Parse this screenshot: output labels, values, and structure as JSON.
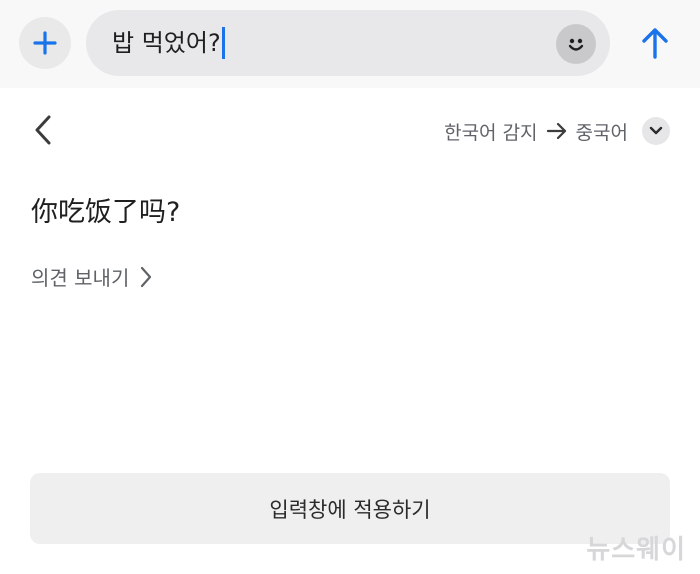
{
  "composer": {
    "input_value": "밥 먹었어?",
    "icons": {
      "add": "plus-icon",
      "emoji": "smiley-icon",
      "send": "arrow-up-icon"
    }
  },
  "translation_panel": {
    "source_language": "한국어 감지",
    "target_language": "중국어",
    "translated_text": "你吃饭了吗?",
    "feedback_label": "의견 보내기",
    "apply_button_label": "입력창에 적용하기"
  },
  "watermark": "뉴스웨이",
  "colors": {
    "accent": "#1a73e8",
    "background": "#ffffff",
    "topbar": "#f8f8f8",
    "pill": "#e8e8ea",
    "secondary_text": "#5f6368"
  }
}
